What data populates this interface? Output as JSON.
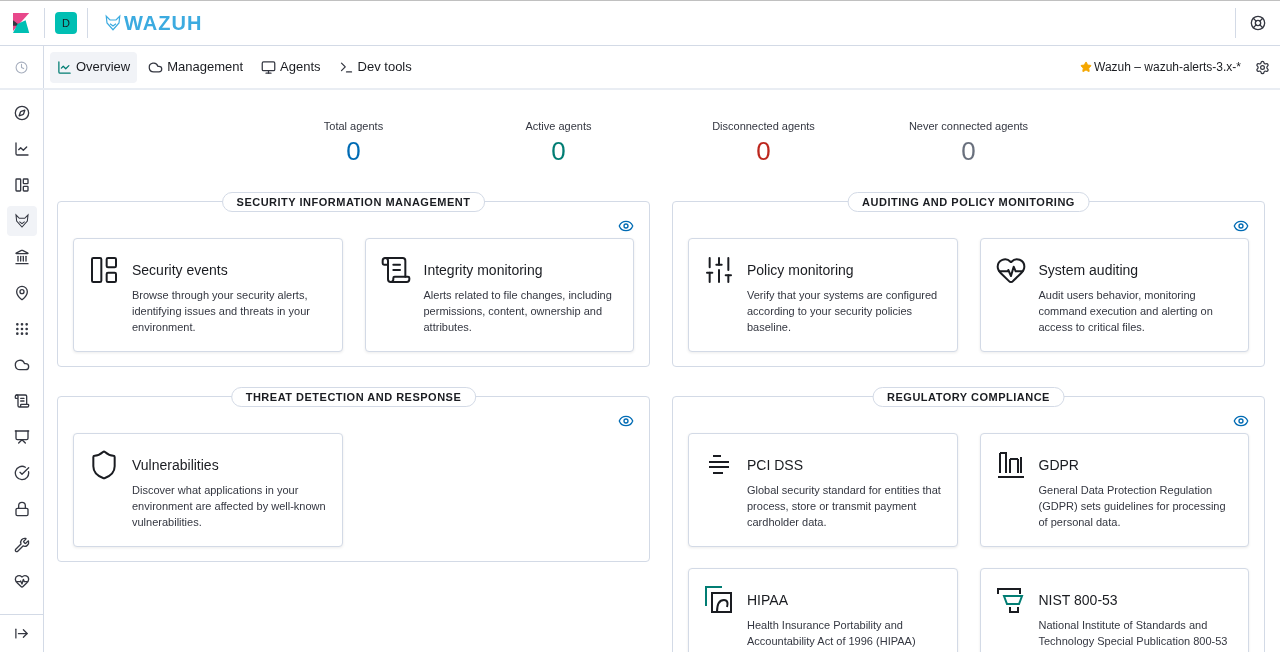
{
  "header": {
    "space_avatar": "D",
    "logo_text": "WAZUH"
  },
  "nav": {
    "tabs": [
      {
        "label": "Overview",
        "selected": true
      },
      {
        "label": "Management",
        "selected": false
      },
      {
        "label": "Agents",
        "selected": false
      },
      {
        "label": "Dev tools",
        "selected": false
      }
    ],
    "index_pattern": "Wazuh – wazuh-alerts-3.x-*"
  },
  "sidebar": {
    "items": [
      {
        "selected": false
      },
      {
        "selected": false
      },
      {
        "selected": false
      },
      {
        "selected": true
      },
      {
        "selected": false
      },
      {
        "selected": false
      },
      {
        "selected": false
      },
      {
        "selected": false
      },
      {
        "selected": false
      },
      {
        "selected": false
      },
      {
        "selected": false
      },
      {
        "selected": false
      },
      {
        "selected": false
      },
      {
        "selected": false
      }
    ]
  },
  "stats": [
    {
      "label": "Total agents",
      "value": "0",
      "color": "#006bb4"
    },
    {
      "label": "Active agents",
      "value": "0",
      "color": "#017d73"
    },
    {
      "label": "Disconnected agents",
      "value": "0",
      "color": "#bd271e"
    },
    {
      "label": "Never connected agents",
      "value": "0",
      "color": "#69707d"
    }
  ],
  "sections": [
    {
      "title": "SECURITY INFORMATION MANAGEMENT",
      "cards": [
        {
          "title": "Security events",
          "description": "Browse through your security alerts, identifying issues and threats in your environment."
        },
        {
          "title": "Integrity monitoring",
          "description": "Alerts related to file changes, including permissions, content, ownership and attributes."
        }
      ]
    },
    {
      "title": "AUDITING AND POLICY MONITORING",
      "cards": [
        {
          "title": "Policy monitoring",
          "description": "Verify that your systems are configured according to your security policies baseline."
        },
        {
          "title": "System auditing",
          "description": "Audit users behavior, monitoring command execution and alerting on access to critical files."
        }
      ]
    },
    {
      "title": "THREAT DETECTION AND RESPONSE",
      "cards": [
        {
          "title": "Vulnerabilities",
          "description": "Discover what applications in your environment are affected by well-known vulnerabilities."
        }
      ]
    },
    {
      "title": "REGULATORY COMPLIANCE",
      "cards": [
        {
          "title": "PCI DSS",
          "description": "Global security standard for entities that process, store or transmit payment cardholder data."
        },
        {
          "title": "GDPR",
          "description": "General Data Protection Regulation (GDPR) sets guidelines for processing of personal data."
        },
        {
          "title": "HIPAA",
          "description": "Health Insurance Portability and Accountability Act of 1996 (HIPAA)"
        },
        {
          "title": "NIST 800-53",
          "description": "National Institute of Standards and Technology Special Publication 800-53"
        }
      ]
    }
  ]
}
